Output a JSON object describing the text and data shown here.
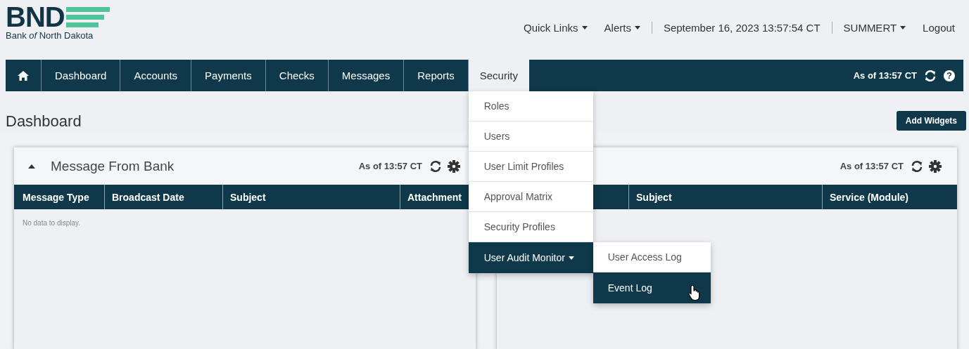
{
  "logo": {
    "mark": "BND",
    "name": "Bank *of* North Dakota"
  },
  "top_links": [
    {
      "kind": "menu",
      "label": "Quick Links",
      "dropdown": true
    },
    {
      "kind": "menu",
      "label": "Alerts",
      "dropdown": true
    },
    {
      "kind": "text",
      "label": "September 16, 2023 13:57:54 CT"
    },
    {
      "kind": "menu",
      "label": "SUMMERT",
      "dropdown": true
    },
    {
      "kind": "link",
      "label": "Logout"
    }
  ],
  "nav": {
    "items": [
      {
        "kind": "home",
        "selected": false
      },
      {
        "kind": "tab",
        "label": "Dashboard",
        "selected": false
      },
      {
        "kind": "tab",
        "label": "Accounts",
        "selected": false
      },
      {
        "kind": "tab",
        "label": "Payments",
        "selected": false
      },
      {
        "kind": "tab",
        "label": "Checks",
        "selected": false
      },
      {
        "kind": "tab",
        "label": "Messages",
        "selected": false
      },
      {
        "kind": "tab",
        "label": "Reports",
        "selected": false
      },
      {
        "kind": "tab",
        "label": "Security",
        "selected": true,
        "expanded": true,
        "menu": [
          {
            "label": "Roles",
            "highlighted": false
          },
          {
            "label": "Users",
            "highlighted": false
          },
          {
            "label": "User Limit Profiles",
            "highlighted": false
          },
          {
            "label": "Approval Matrix",
            "highlighted": false
          },
          {
            "label": "Security Profiles",
            "highlighted": false
          },
          {
            "label": "User Audit Monitor",
            "highlighted": true,
            "dropdown": true,
            "expanded": true,
            "submenu": [
              {
                "label": "User Access Log",
                "highlighted": false
              },
              {
                "label": "Event Log",
                "highlighted": true
              }
            ]
          }
        ]
      }
    ],
    "as_of": "As of 13:57 CT",
    "help": "?"
  },
  "page_title": "Dashboard",
  "add_widgets_button": "Add Widgets",
  "widgets": [
    {
      "expanded": true,
      "title": "Message From Bank",
      "as_of": "As of 13:57 CT",
      "columns": [
        {
          "label": "Message Type"
        },
        {
          "label": "Broadcast Date"
        },
        {
          "label": "Subject"
        },
        {
          "label": "Attachment"
        }
      ],
      "empty_text": "No data to display."
    },
    {
      "as_of": "As of 13:57 CT",
      "columns": [
        {},
        {
          "label": "Subject"
        },
        {
          "label": "Service (Module)"
        }
      ]
    }
  ]
}
